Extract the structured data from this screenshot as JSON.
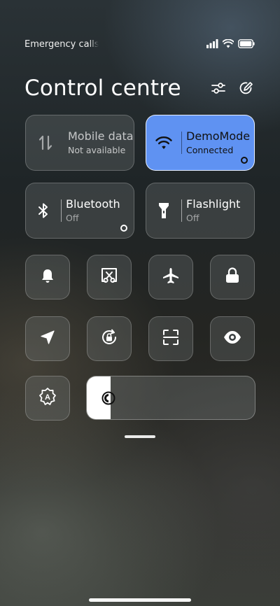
{
  "status_bar": {
    "carrier_text": "Emergency calls only",
    "icons": [
      "signal-icon",
      "wifi-icon",
      "battery-icon"
    ]
  },
  "header": {
    "title": "Control centre",
    "actions": [
      "sliders-icon",
      "edit-icon"
    ]
  },
  "big_tiles": {
    "mobile_data": {
      "title": "Mobile data",
      "subtitle": "Not available",
      "icon": "mobile-data-icon",
      "state": "disabled"
    },
    "wifi": {
      "title": "DemoMode",
      "subtitle": "Connected",
      "icon": "wifi-icon",
      "state": "on"
    },
    "bluetooth": {
      "title": "Bluetooth",
      "subtitle": "Off",
      "icon": "bluetooth-icon",
      "state": "off"
    },
    "flashlight": {
      "title": "Flashlight",
      "subtitle": "Off",
      "icon": "flashlight-icon",
      "state": "off"
    }
  },
  "small_tiles": [
    "bell-icon",
    "screenshot-icon",
    "airplane-icon",
    "lock-icon",
    "location-icon",
    "rotation-lock-icon",
    "scanner-icon",
    "eye-icon",
    "auto-brightness-icon"
  ],
  "brightness": {
    "level": 0.14,
    "icon": "brightness-icon"
  },
  "colors": {
    "accent": "#5f92f2",
    "tile_bg": "#7c8080"
  }
}
